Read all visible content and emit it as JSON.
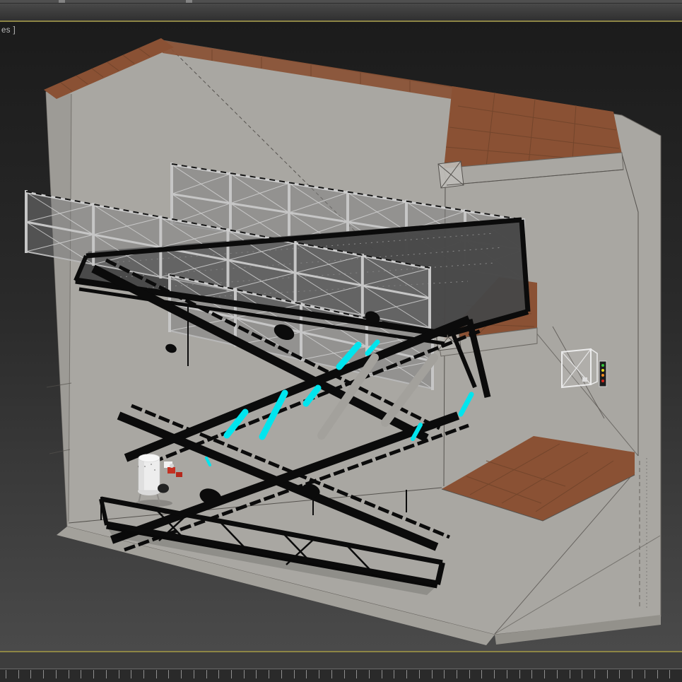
{
  "viewport": {
    "label_fragment": "es ]"
  },
  "timeline": {
    "tick_count": 54
  },
  "colors": {
    "viewport-border": "#8d8545",
    "toolbar-bg": "#3f3f3f",
    "bottombar-bg": "#3d3d3d",
    "trackbar-bg": "#2a2a2a",
    "trackbar-tick": "#8e8e8e",
    "bg-top": "#1b1b1b",
    "bg-bottom": "#4a4a4a",
    "concrete": "#a9a7a2",
    "concrete-shade": "#9b9994",
    "tile-brown": "#8a5134",
    "tile-grout": "#6e432a",
    "steel-black": "#0b0b0b",
    "deck-gray": "#474747",
    "mesh-frame": "#c6c6c6",
    "hydraulic-cyan": "#00e5ee",
    "pump-white": "#ededed",
    "valve-red": "#c43022",
    "label-text": "#bcbcbc"
  },
  "scene": {
    "objects": [
      "concrete pit room",
      "terracotta coping",
      "upper tiled balcony",
      "middle tiled landing",
      "lower tiled landing",
      "mesh guardrail panels",
      "platform deck",
      "double scissor lift mechanism",
      "hydraulic cylinders",
      "hydraulic power unit",
      "wall electrical box",
      "wall control strip"
    ]
  }
}
